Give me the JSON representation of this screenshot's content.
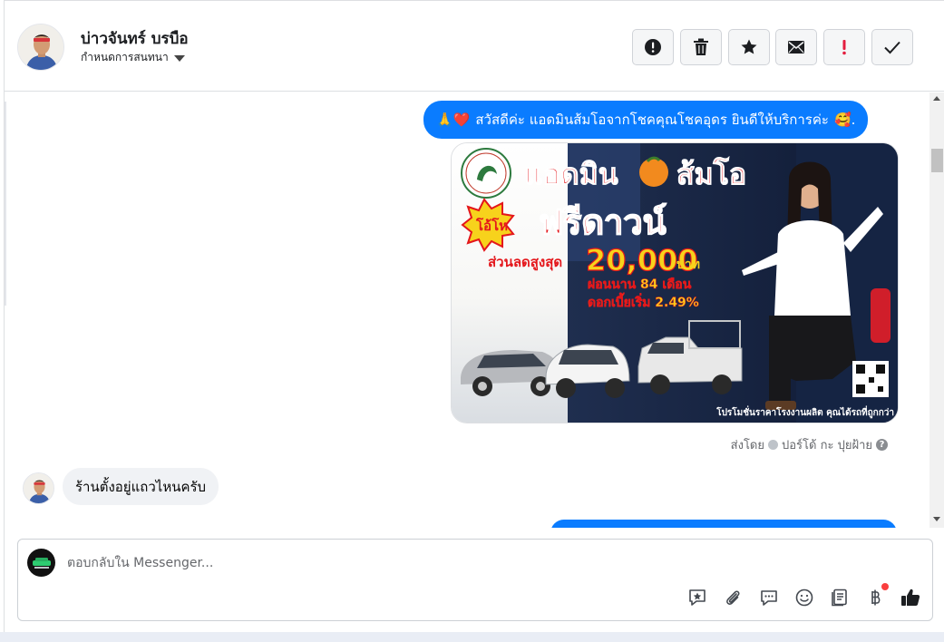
{
  "header": {
    "contact_name": "บ่าวจันทร์ บรบือ",
    "assign_label": "กำหนดการสนทนา"
  },
  "toolbar": {
    "buttons": [
      {
        "name": "spam",
        "icon": "exclamation-circle-icon"
      },
      {
        "name": "delete",
        "icon": "trash-icon"
      },
      {
        "name": "star",
        "icon": "star-icon"
      },
      {
        "name": "unread",
        "icon": "envelope-icon"
      },
      {
        "name": "follow-up",
        "icon": "exclamation-icon",
        "color": "#e41e3f"
      },
      {
        "name": "done",
        "icon": "checkmark-icon"
      }
    ]
  },
  "messages": {
    "greeting": {
      "emoji_prefix": "🙏❤️",
      "text": "สวัสดีค่ะ แอดมินส้มโอจากโชคคุณโชคอุดร ยินดีให้บริการค่ะ",
      "emoji_suffix": "🥰."
    },
    "promo": {
      "headline_1": "แอดมิน",
      "headline_2": "ส้มโอ",
      "badge": "โอ้โห",
      "free_down": "ฟรีดาวน์",
      "discount_label": "ส่วนลดสูงสุด",
      "discount_value": "20,000",
      "discount_unit": "บาท",
      "installment": "ผ่อนนาน 84 เดือน",
      "interest": "ดอกเบี้ยเริ่ม 2.49%",
      "footer": "โปรโมชั่นราคาโรงงานผลิต คุณได้รถที่ถูกกว่า"
    },
    "sent_by": {
      "prefix": "ส่งโดย",
      "agent": "ปอร์โด้ กะ ปุยฝ้าย",
      "help": "?"
    },
    "incoming": {
      "text": "ร้านตั้งอยู่แถวไหนครับ"
    }
  },
  "composer": {
    "placeholder": "ตอบกลับใน Messenger...",
    "icons": [
      "saved-reply-icon",
      "attachment-icon",
      "chat-icon",
      "emoji-icon",
      "notes-icon",
      "baht-payment-icon",
      "like-icon"
    ]
  },
  "colors": {
    "messenger_blue": "#0a7cff",
    "incoming_bubble": "#f0f2f5",
    "alert_red": "#e41e3f"
  }
}
